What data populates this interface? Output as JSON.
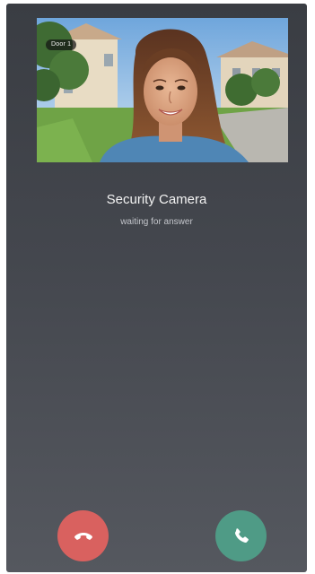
{
  "camera": {
    "label": "Door 1"
  },
  "caller": {
    "name": "Security Camera",
    "status": "waiting for answer"
  },
  "actions": {
    "decline_icon": "phone-hangup-icon",
    "accept_icon": "phone-icon",
    "decline_color": "#d9615f",
    "accept_color": "#4f9b86"
  }
}
